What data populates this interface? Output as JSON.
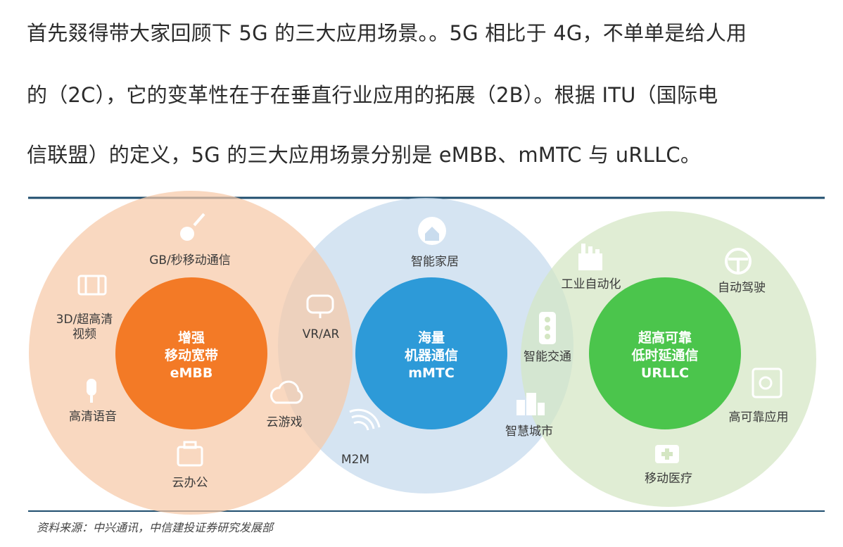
{
  "paragraph": {
    "line1": "首先叕得带大家回顾下 5G 的三大应用场景。。5G 相比于 4G，不单单是给人用",
    "line2": "的（2C），它的变革性在于在垂直行业应用的拓展（2B）。根据 ITU（国际电",
    "line3": "信联盟）的定义，5G 的三大应用场景分别是 eMBB、mMTC 与 uRLLC。"
  },
  "diagram": {
    "colors": {
      "embb_outer": "#f7c9a8",
      "embb_core": "#f37a26",
      "mmtc_outer": "#c9dcee",
      "mmtc_core": "#2d9ad8",
      "urllc_outer": "#d4e6c3",
      "urllc_core": "#4bc54c",
      "rule": "#1f4e6e",
      "icon": "#ffffff"
    },
    "embb": {
      "core_line1": "增强",
      "core_line2": "移动宽带",
      "core_line3": "eMBB",
      "items": {
        "gb": "GB/秒移动通信",
        "video_l1": "3D/超高清",
        "video_l2": "视频",
        "voice": "高清语音",
        "office": "云办公",
        "game": "云游戏",
        "vr": "VR/AR"
      }
    },
    "mmtc": {
      "core_line1": "海量",
      "core_line2": "机器通信",
      "core_line3": "mMTC",
      "items": {
        "home": "智能家居",
        "m2m": "M2M",
        "traffic": "智能交通",
        "city": "智慧城市"
      }
    },
    "urllc": {
      "core_line1": "超高可靠",
      "core_line2": "低时延通信",
      "core_line3": "URLLC",
      "items": {
        "industry": "工业自动化",
        "driving": "自动驾驶",
        "reliable": "高可靠应用",
        "medical": "移动医疗"
      }
    },
    "icons": [
      "rocket-icon",
      "film-icon",
      "microphone-icon",
      "briefcase-icon",
      "cloud-icon",
      "vr-headset-icon",
      "home-icon",
      "signal-icon",
      "traffic-light-icon",
      "buildings-icon",
      "factory-icon",
      "steering-wheel-icon",
      "safe-icon",
      "first-aid-icon"
    ]
  },
  "source": "资料来源：中兴通讯，中信建投证券研究发展部"
}
